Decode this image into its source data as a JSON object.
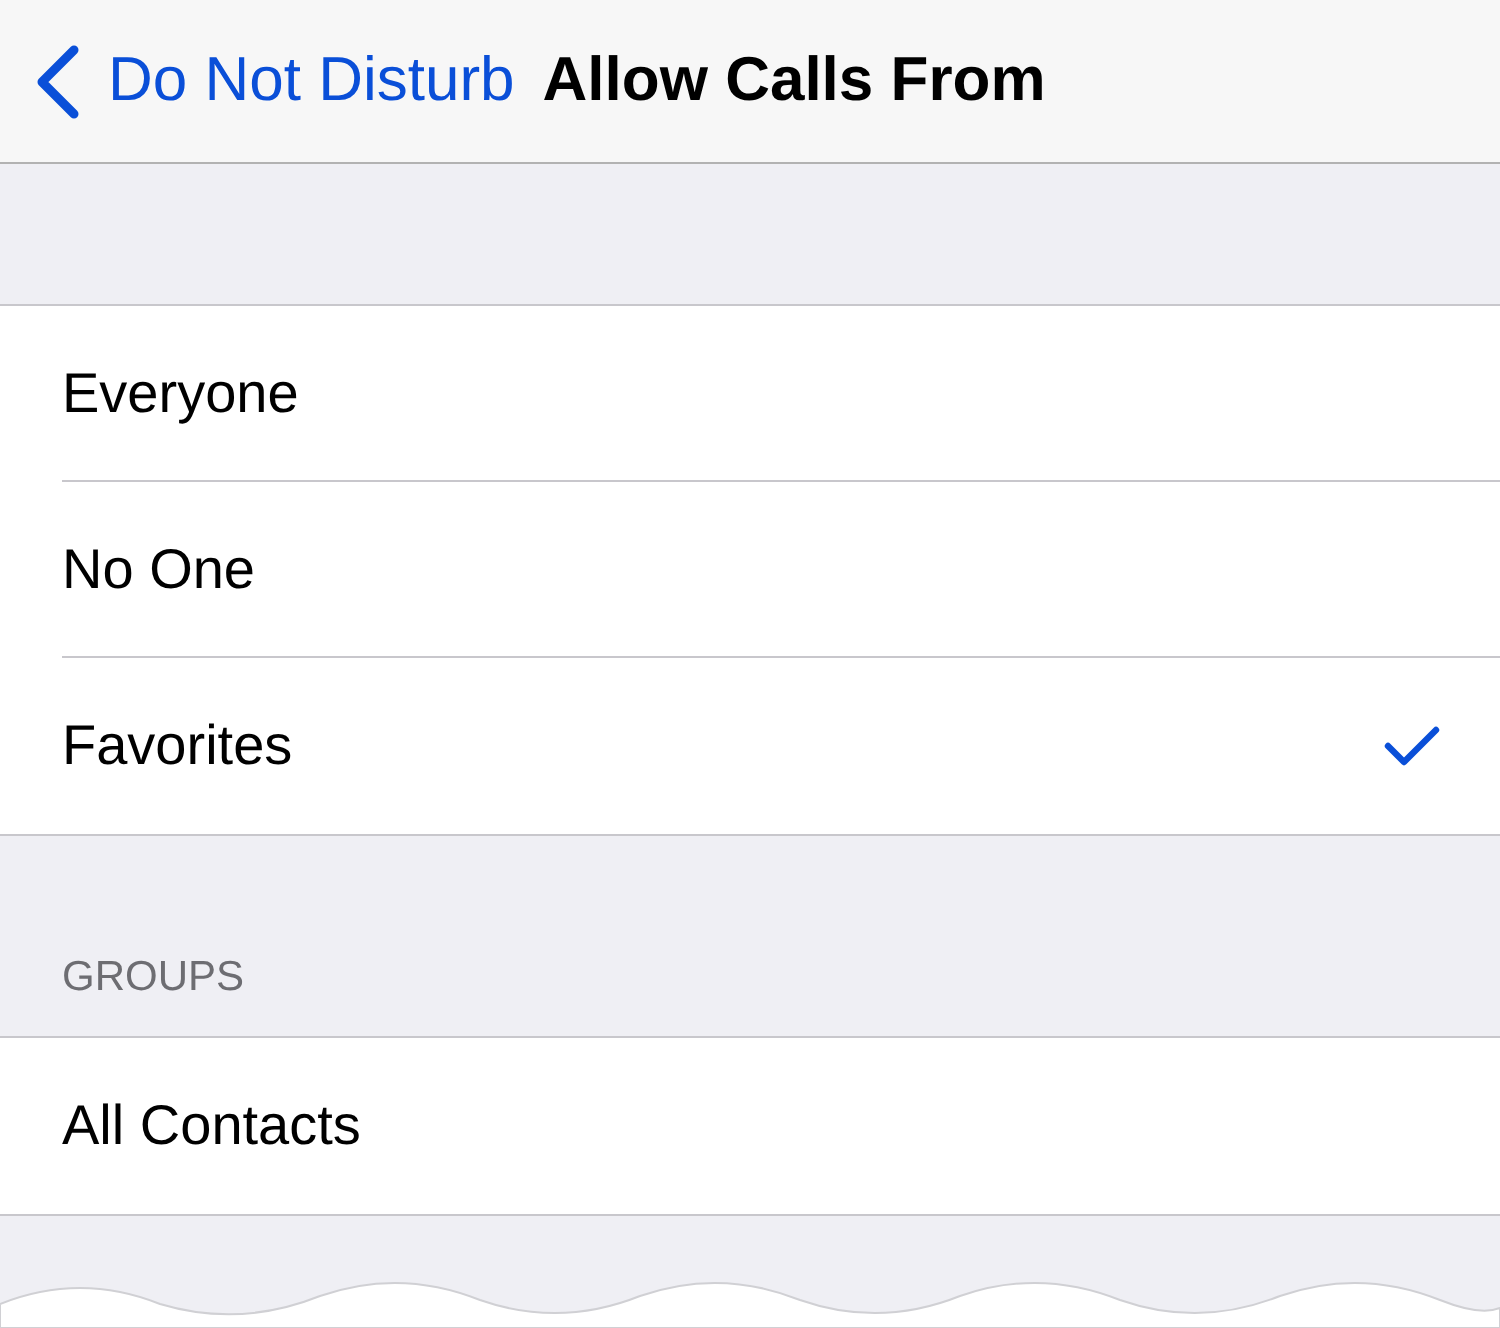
{
  "nav_bar": {
    "back_label": "Do Not Disturb",
    "title": "Allow Calls From"
  },
  "options": [
    {
      "label": "Everyone",
      "selected": false
    },
    {
      "label": "No One",
      "selected": false
    },
    {
      "label": "Favorites",
      "selected": true
    }
  ],
  "groups": {
    "header": "GROUPS",
    "items": [
      {
        "label": "All Contacts",
        "selected": false
      }
    ]
  }
}
